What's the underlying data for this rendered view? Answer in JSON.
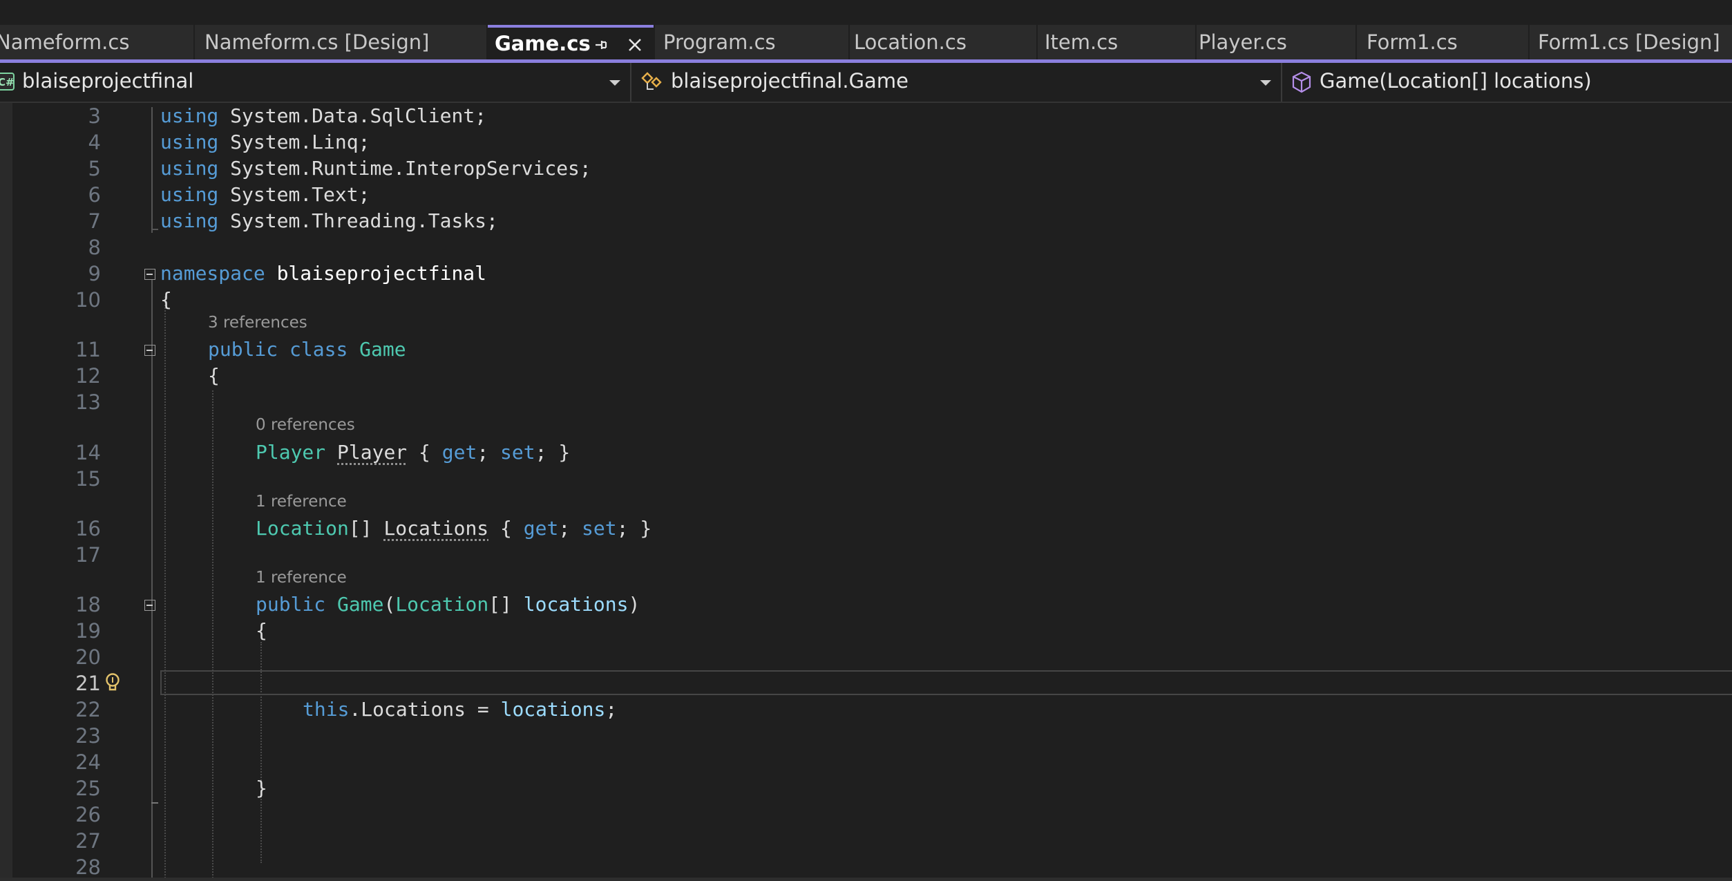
{
  "tabs": [
    {
      "label": "Nameform.cs"
    },
    {
      "label": "Nameform.cs [Design]"
    },
    {
      "label": "Game.cs"
    },
    {
      "label": "Program.cs"
    },
    {
      "label": "Location.cs"
    },
    {
      "label": "Item.cs"
    },
    {
      "label": "Player.cs"
    },
    {
      "label": "Form1.cs"
    },
    {
      "label": "Form1.cs [Design]"
    }
  ],
  "navbar": {
    "project": "blaiseprojectfinal",
    "type": "blaiseprojectfinal.Game",
    "member": "Game(Location[] locations)"
  },
  "editor": {
    "line_numbers": [
      "3",
      "4",
      "5",
      "6",
      "7",
      "8",
      "9",
      "10",
      "11",
      "12",
      "13",
      "14",
      "15",
      "16",
      "17",
      "18",
      "19",
      "20",
      "21",
      "22",
      "23",
      "24",
      "25",
      "26",
      "27",
      "28"
    ],
    "codelens": {
      "class_refs": "3 references",
      "player_refs": "0 references",
      "locations_refs": "1 reference",
      "ctor_refs": "1 reference"
    },
    "tokens": {
      "using": "using",
      "system": "System",
      "data": "Data",
      "sqlclient": "SqlClient",
      "linq": "Linq",
      "runtime": "Runtime",
      "interop": "InteropServices",
      "text": "Text",
      "threading": "Threading",
      "tasks": "Tasks",
      "namespace": "namespace",
      "ns_name": "blaiseprojectfinal",
      "public": "public",
      "class": "class",
      "game": "Game",
      "player_type": "Player",
      "player_prop": "Player",
      "get": "get",
      "set": "set",
      "location_type": "Location",
      "locations_prop": "Locations",
      "locations_param": "locations",
      "this": "this"
    }
  },
  "colors": {
    "keyword": "#569cd6",
    "type": "#4ec9b0",
    "identifier": "#9cdcfe",
    "accent": "#8b7fde"
  }
}
